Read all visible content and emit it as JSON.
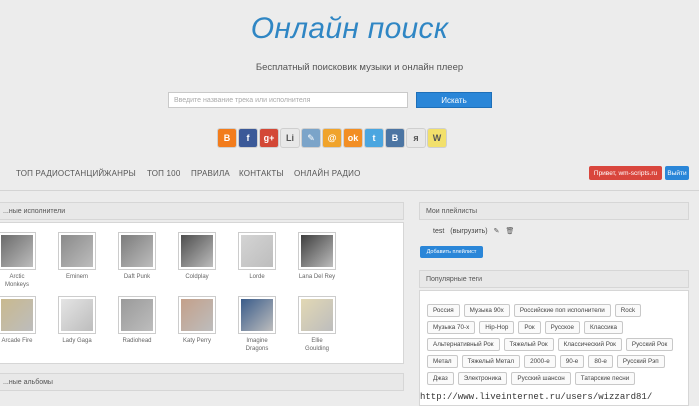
{
  "header": {
    "title": "Онлайн поиск",
    "subtitle": "Бесплатный поисковик музыки и онлайн плеер"
  },
  "search": {
    "placeholder": "Введите название трека или исполнителя",
    "button_label": "Искать"
  },
  "social_icons": [
    {
      "name": "blogger-icon",
      "glyph": "B",
      "color": "#f27c1c"
    },
    {
      "name": "facebook-icon",
      "glyph": "f",
      "color": "#3b5998"
    },
    {
      "name": "googleplus-icon",
      "glyph": "g+",
      "color": "#d34836"
    },
    {
      "name": "liveinternet-icon",
      "glyph": "Li",
      "color": "#e8e8e8"
    },
    {
      "name": "livejournal-icon",
      "glyph": "✎",
      "color": "#7ba4c9"
    },
    {
      "name": "mail-icon",
      "glyph": "@",
      "color": "#f0a32b"
    },
    {
      "name": "odnoklassniki-icon",
      "glyph": "ok",
      "color": "#f28e24"
    },
    {
      "name": "twitter-icon",
      "glyph": "t",
      "color": "#4aa6e0"
    },
    {
      "name": "vk-icon",
      "glyph": "B",
      "color": "#4c75a3"
    },
    {
      "name": "yaru-icon",
      "glyph": "я",
      "color": "#e8e8e8"
    },
    {
      "name": "wordpress-icon",
      "glyph": "W",
      "color": "#f2e06b"
    }
  ],
  "nav": {
    "items": [
      "ТОП РАДИОСТАНЦИЙ",
      "ЖАНРЫ",
      "ТОП 100",
      "ПРАВИЛА",
      "КОНТАКТЫ",
      "ОНЛАЙН РАДИО"
    ],
    "promo_label": "Привет, wm-scripts.ru",
    "login_label": "Выйти"
  },
  "artists_panel": {
    "title": "...ные исполнители",
    "artists": [
      {
        "name": "Arctic\nMonkeys",
        "color": "#6b6b6b"
      },
      {
        "name": "Eminem",
        "color": "#8a8a8a"
      },
      {
        "name": "Daft Punk",
        "color": "#7c7c7c"
      },
      {
        "name": "Coldplay",
        "color": "#4e4e4e"
      },
      {
        "name": "Lorde",
        "color": "#d4d4d4"
      },
      {
        "name": "Lana Del Rey",
        "color": "#3e3e3e"
      },
      {
        "name": "Arcade Fire",
        "color": "#c9b98e"
      },
      {
        "name": "Lady Gaga",
        "color": "#e4e4e4"
      },
      {
        "name": "Radiohead",
        "color": "#9a9a9a"
      },
      {
        "name": "Katy Perry",
        "color": "#c4a08a"
      },
      {
        "name": "Imagine\nDragons",
        "color": "#3a5c8a"
      },
      {
        "name": "Ellie\nGoulding",
        "color": "#e2d8b4"
      }
    ]
  },
  "albums_panel": {
    "title": "...ные альбомы"
  },
  "playlists_panel": {
    "title": "Мои плейлисты",
    "playlist_name": "test",
    "export_label": "(выгрузить)",
    "add_label": "Добавить плейлист"
  },
  "tags_panel": {
    "title": "Популярные теги",
    "tags": [
      "Россия",
      "Музыка 90х",
      "Российские поп исполнители",
      "Rock",
      "Музыка 70-х",
      "Hip-Hop",
      "Рок",
      "Русское",
      "Классика",
      "Альтернативный Рок",
      "Тяжелый Рок",
      "Классический Рок",
      "Русский Рок",
      "Метал",
      "Тяжелый Метал",
      "2000-е",
      "90-е",
      "80-е",
      "Русский Рэп",
      "Джаз",
      "Электроника",
      "Русский шансон",
      "Татарские песни"
    ]
  },
  "watermark": "http://www.liveinternet.ru/users/wizzard81/"
}
